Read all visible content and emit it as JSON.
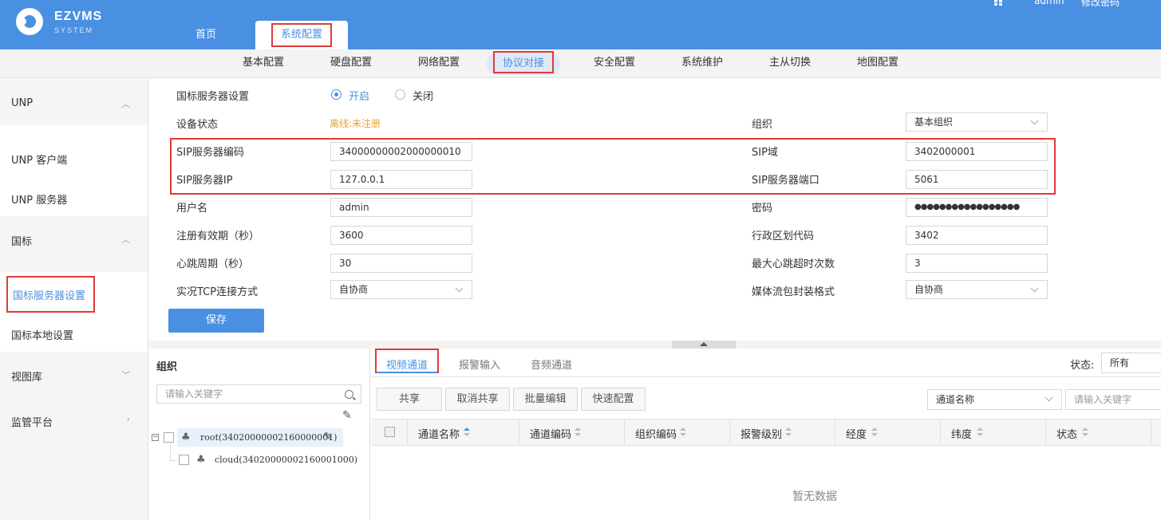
{
  "header": {
    "brand": "EZVMS",
    "brand_sub": "SYSTEM",
    "tabs": [
      {
        "label": "首页"
      },
      {
        "label": "系统配置"
      }
    ],
    "user": "admin",
    "change_password": "修改密码"
  },
  "subnav": [
    "基本配置",
    "硬盘配置",
    "网络配置",
    "协议对接",
    "安全配置",
    "系统维护",
    "主从切换",
    "地图配置"
  ],
  "sidebar": {
    "unp": "UNP",
    "unp_client": "UNP 客户端",
    "unp_server": "UNP 服务器",
    "gb": "国标",
    "gb_server": "国标服务器设置",
    "gb_local": "国标本地设置",
    "view_lib": "视图库",
    "monitor": "监管平台"
  },
  "form": {
    "gb_server_setting": "国标服务器设置",
    "on": "开启",
    "off": "关闭",
    "device_status_label": "设备状态",
    "device_status": "离线:未注册",
    "org_label": "组织",
    "org_value": "基本组织",
    "sip_code_label": "SIP服务器编码",
    "sip_code": "34000000002000000010",
    "sip_domain_label": "SIP域",
    "sip_domain": "3402000001",
    "sip_ip_label": "SIP服务器IP",
    "sip_ip": "127.0.0.1",
    "sip_port_label": "SIP服务器端口",
    "sip_port": "5061",
    "username_label": "用户名",
    "username": "admin",
    "password_label": "密码",
    "password": "●●●●●●●●●●●●●●●●●",
    "reg_period_label": "注册有效期（秒）",
    "reg_period": "3600",
    "region_code_label": "行政区划代码",
    "region_code": "3402",
    "heartbeat_label": "心跳周期（秒）",
    "heartbeat": "30",
    "max_hb_label": "最大心跳超时次数",
    "max_hb": "3",
    "tcp_mode_label": "实况TCP连接方式",
    "tcp_mode": "自协商",
    "stream_fmt_label": "媒体流包封装格式",
    "stream_fmt": "自协商",
    "save": "保存"
  },
  "tree": {
    "title": "组织",
    "search_placeholder": "请输入关键字",
    "root": "root(34020000002160000001)",
    "cloud": "cloud(34020000002160001000)"
  },
  "channels": {
    "tabs": [
      "视频通道",
      "报警输入",
      "音频通道"
    ],
    "status_label": "状态:",
    "status_value": "所有",
    "buttons": [
      "共享",
      "取消共享",
      "批量编辑",
      "快速配置"
    ],
    "filter_field": "通道名称",
    "filter_placeholder": "请输入关键字",
    "columns": [
      "通道名称",
      "通道编码",
      "组织编码",
      "报警级别",
      "经度",
      "纬度",
      "状态"
    ],
    "empty": "暂无数据"
  },
  "colors": {
    "accent": "#4a90e2",
    "highlight": "#e03a3a",
    "warning": "#e6a23c"
  }
}
